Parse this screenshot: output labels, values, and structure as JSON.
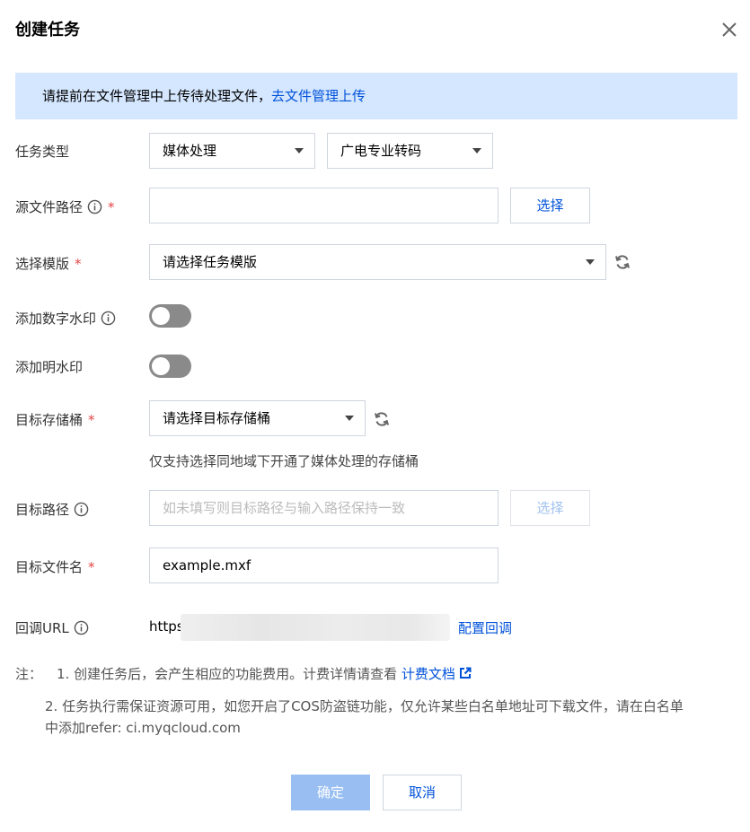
{
  "dialog": {
    "title": "创建任务"
  },
  "notice": {
    "text": "请提前在文件管理中上传待处理文件，",
    "link": "去文件管理上传"
  },
  "task_type": {
    "label": "任务类型",
    "category": "媒体处理",
    "subtype": "广电专业转码"
  },
  "source_path": {
    "label": "源文件路径",
    "value": "",
    "select_button": "选择"
  },
  "template": {
    "label": "选择模版",
    "placeholder": "请选择任务模版"
  },
  "digital_watermark": {
    "label": "添加数字水印",
    "enabled": false
  },
  "visible_watermark": {
    "label": "添加明水印",
    "enabled": false
  },
  "target_bucket": {
    "label": "目标存储桶",
    "placeholder": "请选择目标存储桶",
    "hint": "仅支持选择同地域下开通了媒体处理的存储桶"
  },
  "target_path": {
    "label": "目标路径",
    "placeholder": "如未填写则目标路径与输入路径保持一致",
    "select_button": "选择"
  },
  "target_filename": {
    "label": "目标文件名",
    "value": "example.mxf"
  },
  "callback": {
    "label": "回调URL",
    "value_prefix": "https",
    "config_link": "配置回调"
  },
  "notes": {
    "prefix": "注：",
    "note1_num": "1.",
    "note1_text": "创建任务后，会产生相应的功能费用。计费详情请查看",
    "note1_link": "计费文档",
    "note2_line1": "2. 任务执行需保证资源可用，如您开启了COS防盗链功能，仅允许某些白名单地址可下载文件，请在白名单",
    "note2_line2": "中添加refer: ci.myqcloud.com"
  },
  "footer": {
    "confirm": "确定",
    "cancel": "取消"
  },
  "colors": {
    "accent": "#0052d9",
    "notice_bg": "#d5e7ff",
    "required": "#e54545",
    "toggle_off": "#8a8a8a",
    "primary_disabled": "#99bff2"
  }
}
